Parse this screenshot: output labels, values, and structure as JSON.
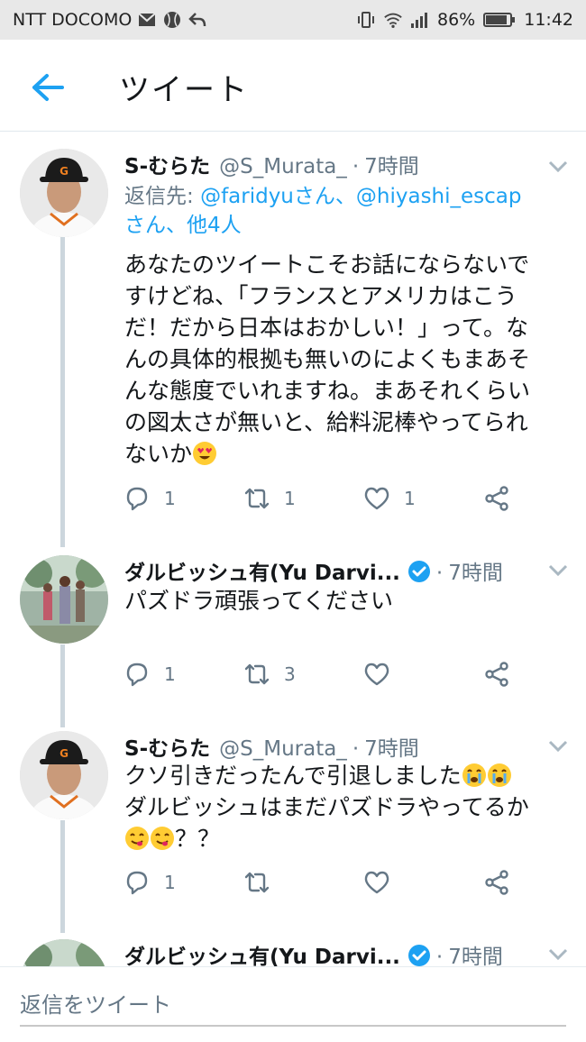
{
  "status_bar": {
    "carrier": "NTT DOCOMO",
    "battery": "86%",
    "time": "11:42"
  },
  "header": {
    "title": "ツイート"
  },
  "tweets": [
    {
      "name": "S-むらた",
      "handle": "@S_Murata_",
      "separator": "·",
      "time": "7時間",
      "reply_prefix": "返信先: ",
      "reply_user1": "@faridyuさん、",
      "reply_user2": "@hiyashi_escap",
      "reply_user3": "さん、他4人",
      "text_lines": [
        "あなたのツイートこそお話にならないで",
        "すけどね、「フランスとアメリカはこう",
        "だ！だから日本はおかしい！」って。な",
        "んの具体的根拠も無いのによくもまあそ",
        "んな態度でいれますね。まあそれくらい",
        "の図太さが無いと、給料泥棒やってられ",
        "ないか"
      ],
      "reply_count": "1",
      "retweet_count": "1",
      "like_count": "1"
    },
    {
      "name": "ダルビッシュ有(Yu Darvi...",
      "separator": "·",
      "time": "7時間",
      "text_lines": [
        "パズドラ頑張ってください"
      ],
      "reply_count": "1",
      "retweet_count": "3",
      "like_count": ""
    },
    {
      "name": "S-むらた",
      "handle": "@S_Murata_",
      "separator": "·",
      "time": "7時間",
      "text_lines": [
        "クソ引きだったんで引退しました",
        "ダルビッシュはまだパズドラやってるか",
        "？？"
      ],
      "reply_count": "1",
      "retweet_count": "",
      "like_count": ""
    },
    {
      "name": "ダルビッシュ有(Yu Darvi...",
      "separator": "·",
      "time": "7時間"
    }
  ],
  "reply_bar": {
    "placeholder": "返信をツイート"
  },
  "colors": {
    "accent": "#1da1f2",
    "secondary_text": "#657786",
    "thread_line": "#ccd6dd",
    "emoji_yellow": "#ffcc33"
  },
  "icons": {
    "back": "arrow-left-icon",
    "reply": "reply-icon",
    "retweet": "retweet-icon",
    "like": "heart-icon",
    "share": "share-icon",
    "caret": "chevron-down-icon",
    "verified": "verified-badge-icon"
  }
}
